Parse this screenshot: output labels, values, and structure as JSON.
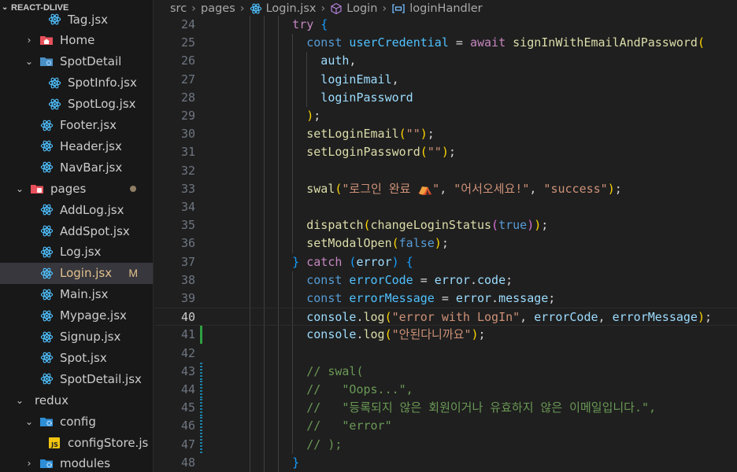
{
  "explorer": {
    "title": "REACT-DLIVE",
    "items": [
      {
        "label": "Tag.jsx",
        "type": "react",
        "depth": 3
      },
      {
        "label": "Home",
        "type": "folder-home",
        "depth": 1,
        "chevron": "›"
      },
      {
        "label": "SpotDetail",
        "type": "folder",
        "depth": 1,
        "chevron": "⌄"
      },
      {
        "label": "SpotInfo.jsx",
        "type": "react",
        "depth": 3
      },
      {
        "label": "SpotLog.jsx",
        "type": "react",
        "depth": 3
      },
      {
        "label": "Footer.jsx",
        "type": "react",
        "depth": 2
      },
      {
        "label": "Header.jsx",
        "type": "react",
        "depth": 2
      },
      {
        "label": "NavBar.jsx",
        "type": "react",
        "depth": 2
      },
      {
        "label": "pages",
        "type": "folder-pages",
        "depth": 0,
        "chevron": "⌄",
        "dot": true
      },
      {
        "label": "AddLog.jsx",
        "type": "react",
        "depth": 2
      },
      {
        "label": "AddSpot.jsx",
        "type": "react",
        "depth": 2
      },
      {
        "label": "Log.jsx",
        "type": "react",
        "depth": 2
      },
      {
        "label": "Login.jsx",
        "type": "react",
        "depth": 2,
        "selected": true,
        "badge": "M"
      },
      {
        "label": "Main.jsx",
        "type": "react",
        "depth": 2
      },
      {
        "label": "Mypage.jsx",
        "type": "react",
        "depth": 2
      },
      {
        "label": "Signup.jsx",
        "type": "react",
        "depth": 2
      },
      {
        "label": "Spot.jsx",
        "type": "react",
        "depth": 2
      },
      {
        "label": "SpotDetail.jsx",
        "type": "react",
        "depth": 2
      },
      {
        "label": "redux",
        "type": "plain-folder",
        "depth": 0,
        "chevron": "⌄"
      },
      {
        "label": "config",
        "type": "folder-config",
        "depth": 1,
        "chevron": "⌄"
      },
      {
        "label": "configStore.js",
        "type": "js",
        "depth": 3
      },
      {
        "label": "modules",
        "type": "folder-config",
        "depth": 1,
        "chevron": "›"
      }
    ]
  },
  "breadcrumb": {
    "parts": [
      "src",
      "pages",
      "Login.jsx",
      "Login",
      "loginHandler"
    ]
  },
  "editor": {
    "active_line": 40,
    "lines": [
      {
        "n": 24,
        "ind": 6,
        "t": [
          [
            "try ",
            "kw"
          ],
          [
            "{",
            "p3"
          ]
        ]
      },
      {
        "n": 25,
        "ind": 8,
        "t": [
          [
            "const ",
            "st"
          ],
          [
            "userCredential",
            "var"
          ],
          [
            " = ",
            "pl"
          ],
          [
            "await ",
            "kw"
          ],
          [
            "signInWithEmailAndPassword",
            "fn"
          ],
          [
            "(",
            "p1"
          ]
        ]
      },
      {
        "n": 26,
        "ind": 10,
        "t": [
          [
            "auth",
            "vr"
          ],
          [
            ",",
            "pl"
          ]
        ]
      },
      {
        "n": 27,
        "ind": 10,
        "t": [
          [
            "loginEmail",
            "vr"
          ],
          [
            ",",
            "pl"
          ]
        ]
      },
      {
        "n": 28,
        "ind": 10,
        "t": [
          [
            "loginPassword",
            "vr"
          ]
        ]
      },
      {
        "n": 29,
        "ind": 8,
        "t": [
          [
            ")",
            "p1"
          ],
          [
            ";",
            "pl"
          ]
        ]
      },
      {
        "n": 30,
        "ind": 8,
        "t": [
          [
            "setLoginEmail",
            "fn"
          ],
          [
            "(",
            "p1"
          ],
          [
            "\"\"",
            "str"
          ],
          [
            ")",
            "p1"
          ],
          [
            ";",
            "pl"
          ]
        ]
      },
      {
        "n": 31,
        "ind": 8,
        "t": [
          [
            "setLoginPassword",
            "fn"
          ],
          [
            "(",
            "p1"
          ],
          [
            "\"\"",
            "str"
          ],
          [
            ")",
            "p1"
          ],
          [
            ";",
            "pl"
          ]
        ]
      },
      {
        "n": 32,
        "ind": 0,
        "t": []
      },
      {
        "n": 33,
        "ind": 8,
        "t": [
          [
            "swal",
            "fn"
          ],
          [
            "(",
            "p1"
          ],
          [
            "\"로그인 완료 ⛺\"",
            "str"
          ],
          [
            ", ",
            "pl"
          ],
          [
            "\"어서오세요!\"",
            "str"
          ],
          [
            ", ",
            "pl"
          ],
          [
            "\"success\"",
            "str"
          ],
          [
            ")",
            "p1"
          ],
          [
            ";",
            "pl"
          ]
        ]
      },
      {
        "n": 34,
        "ind": 0,
        "t": []
      },
      {
        "n": 35,
        "ind": 8,
        "t": [
          [
            "dispatch",
            "fn"
          ],
          [
            "(",
            "p1"
          ],
          [
            "changeLoginStatus",
            "fn"
          ],
          [
            "(",
            "p2"
          ],
          [
            "true",
            "st"
          ],
          [
            ")",
            "p2"
          ],
          [
            ")",
            "p1"
          ],
          [
            ";",
            "pl"
          ]
        ]
      },
      {
        "n": 36,
        "ind": 8,
        "t": [
          [
            "setModalOpen",
            "fn"
          ],
          [
            "(",
            "p1"
          ],
          [
            "false",
            "st"
          ],
          [
            ")",
            "p1"
          ],
          [
            ";",
            "pl"
          ]
        ]
      },
      {
        "n": 37,
        "ind": 6,
        "t": [
          [
            "}",
            "p3"
          ],
          [
            " catch ",
            "kw"
          ],
          [
            "(",
            "p3"
          ],
          [
            "error",
            "vr"
          ],
          [
            ")",
            "p3"
          ],
          [
            " {",
            "p3"
          ]
        ]
      },
      {
        "n": 38,
        "ind": 8,
        "t": [
          [
            "const ",
            "st"
          ],
          [
            "errorCode",
            "var"
          ],
          [
            " = ",
            "pl"
          ],
          [
            "error",
            "vr"
          ],
          [
            ".",
            "pl"
          ],
          [
            "code",
            "vr"
          ],
          [
            ";",
            "pl"
          ]
        ]
      },
      {
        "n": 39,
        "ind": 8,
        "t": [
          [
            "const ",
            "st"
          ],
          [
            "errorMessage",
            "var"
          ],
          [
            " = ",
            "pl"
          ],
          [
            "error",
            "vr"
          ],
          [
            ".",
            "pl"
          ],
          [
            "message",
            "vr"
          ],
          [
            ";",
            "pl"
          ]
        ]
      },
      {
        "n": 40,
        "ind": 8,
        "t": [
          [
            "console",
            "vr"
          ],
          [
            ".",
            "pl"
          ],
          [
            "log",
            "fn"
          ],
          [
            "(",
            "p1"
          ],
          [
            "\"error with LogIn\"",
            "str"
          ],
          [
            ", ",
            "pl"
          ],
          [
            "errorCode",
            "vr"
          ],
          [
            ", ",
            "pl"
          ],
          [
            "errorMessage",
            "vr"
          ],
          [
            ")",
            "p1"
          ],
          [
            ";",
            "pl"
          ]
        ]
      },
      {
        "n": 41,
        "ind": 8,
        "t": [
          [
            "console",
            "vr"
          ],
          [
            ".",
            "pl"
          ],
          [
            "log",
            "fn"
          ],
          [
            "(",
            "p1"
          ],
          [
            "\"안된다니까요\"",
            "str"
          ],
          [
            ")",
            "p1"
          ],
          [
            ";",
            "pl"
          ]
        ]
      },
      {
        "n": 42,
        "ind": 0,
        "t": []
      },
      {
        "n": 43,
        "ind": 8,
        "t": [
          [
            "// swal(",
            "cm"
          ]
        ]
      },
      {
        "n": 44,
        "ind": 8,
        "t": [
          [
            "//   \"Oops...\",",
            "cm"
          ]
        ]
      },
      {
        "n": 45,
        "ind": 8,
        "t": [
          [
            "//   \"등록되지 않은 회원이거나 유효하지 않은 이메일입니다.\",",
            "cm"
          ]
        ]
      },
      {
        "n": 46,
        "ind": 8,
        "t": [
          [
            "//   \"error\"",
            "cm"
          ]
        ]
      },
      {
        "n": 47,
        "ind": 8,
        "t": [
          [
            "// );",
            "cm"
          ]
        ]
      },
      {
        "n": 48,
        "ind": 6,
        "t": [
          [
            "}",
            "p3"
          ]
        ]
      }
    ]
  }
}
